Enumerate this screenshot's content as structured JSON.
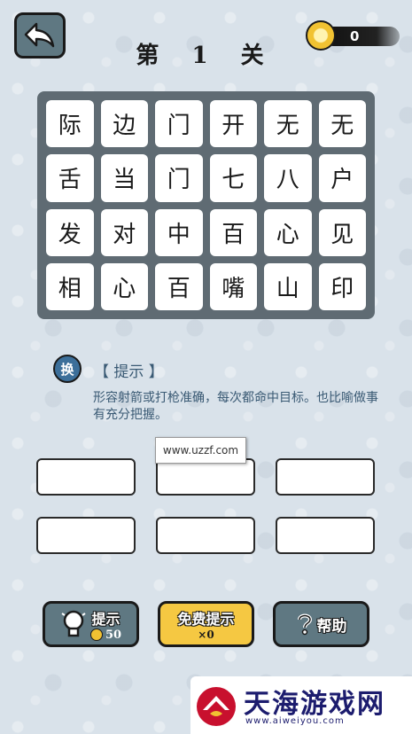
{
  "header": {
    "title": "第 1 关",
    "coins": "0"
  },
  "grid": [
    [
      "际",
      "边",
      "门",
      "开",
      "无",
      "无"
    ],
    [
      "舌",
      "当",
      "门",
      "七",
      "八",
      "户"
    ],
    [
      "发",
      "对",
      "中",
      "百",
      "心",
      "见"
    ],
    [
      "相",
      "心",
      "百",
      "嘴",
      "山",
      "印"
    ]
  ],
  "hint": {
    "swap_icon_text": "换",
    "title": "【 提示 】",
    "text": "形容射箭或打枪准确，每次都命中目标。也比喻做事有充分把握。"
  },
  "tooltip": "www.uzzf.com",
  "buttons": {
    "hint_label": "提示",
    "hint_cost": "50",
    "free_label": "免费提示",
    "free_count": "×0",
    "help_label": "帮助"
  },
  "watermark": {
    "title": "天海游戏网",
    "url": "www.aiweiyou.com"
  },
  "colors": {
    "panel": "#5f6b73",
    "button": "#5f7882",
    "free_button": "#f5c842",
    "hint_text": "#3a5a74"
  }
}
